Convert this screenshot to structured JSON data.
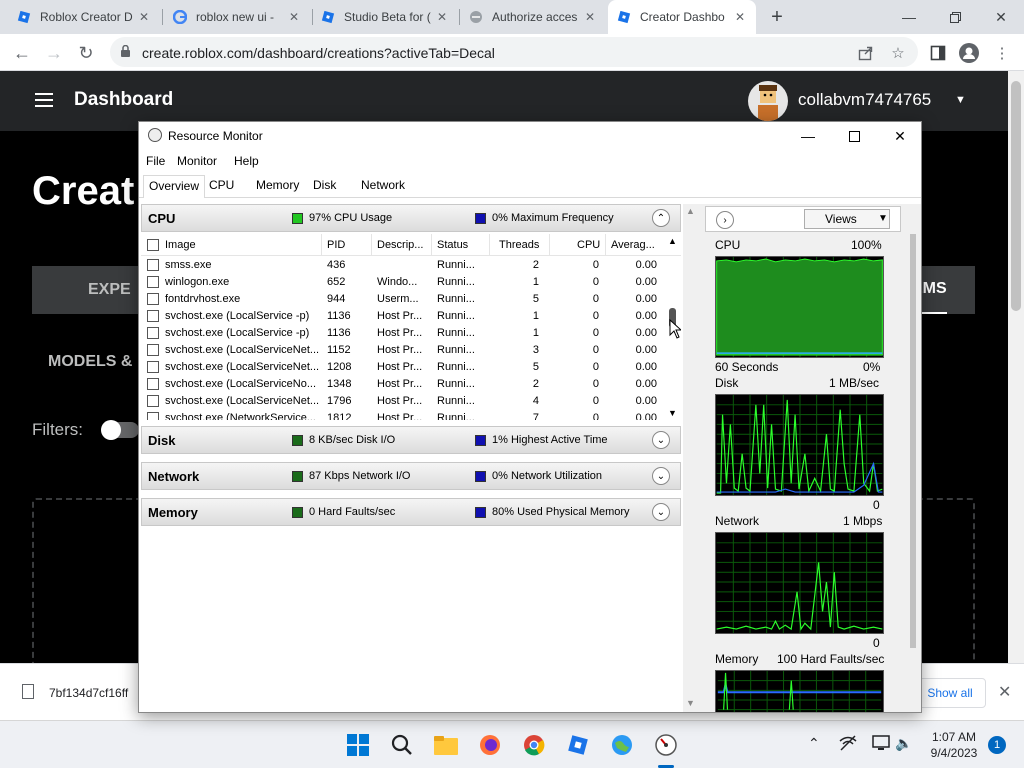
{
  "browser": {
    "tabs": [
      {
        "title": "Roblox Creator D",
        "icon": "roblox-icon"
      },
      {
        "title": "roblox new ui -",
        "icon": "google-icon"
      },
      {
        "title": "Studio Beta for (",
        "icon": "roblox-icon"
      },
      {
        "title": "Authorize acces",
        "icon": "page-icon"
      },
      {
        "title": "Creator Dashbo",
        "icon": "roblox-icon"
      }
    ],
    "url": "create.roblox.com/dashboard/creations?activeTab=Decal"
  },
  "roblox": {
    "header_title": "Dashboard",
    "username": "collabvm7474765",
    "page_heading": "Creat",
    "tab_experiences": "EXPE",
    "tab_items": "EMS",
    "models_tab": "MODELS &",
    "filters_label": "Filters:"
  },
  "download": {
    "filename": "7bf134d7cf16ff",
    "show_all": "Show all"
  },
  "taskbar": {
    "time": "1:07 AM",
    "date": "9/4/2023",
    "notifications": "1"
  },
  "resmon": {
    "title": "Resource Monitor",
    "menu": [
      "File",
      "Monitor",
      "Help"
    ],
    "tabs": [
      "Overview",
      "CPU",
      "Memory",
      "Disk",
      "Network"
    ],
    "cpu": {
      "name": "CPU",
      "stat1": "97% CPU Usage",
      "stat2": "0% Maximum Frequency"
    },
    "disk": {
      "name": "Disk",
      "stat1": "8 KB/sec Disk I/O",
      "stat2": "1% Highest Active Time"
    },
    "network": {
      "name": "Network",
      "stat1": "87 Kbps Network I/O",
      "stat2": "0% Network Utilization"
    },
    "memory": {
      "name": "Memory",
      "stat1": "0 Hard Faults/sec",
      "stat2": "80% Used Physical Memory"
    },
    "columns": [
      "Image",
      "PID",
      "Descrip...",
      "Status",
      "Threads",
      "CPU",
      "Averag..."
    ],
    "processes": [
      [
        "smss.exe",
        "436",
        "",
        "Runni...",
        "2",
        "0",
        "0.00"
      ],
      [
        "winlogon.exe",
        "652",
        "Windo...",
        "Runni...",
        "1",
        "0",
        "0.00"
      ],
      [
        "fontdrvhost.exe",
        "944",
        "Userm...",
        "Runni...",
        "5",
        "0",
        "0.00"
      ],
      [
        "svchost.exe (LocalService -p)",
        "1136",
        "Host Pr...",
        "Runni...",
        "1",
        "0",
        "0.00"
      ],
      [
        "svchost.exe (LocalService -p)",
        "1136",
        "Host Pr...",
        "Runni...",
        "1",
        "0",
        "0.00"
      ],
      [
        "svchost.exe (LocalServiceNet...",
        "1152",
        "Host Pr...",
        "Runni...",
        "3",
        "0",
        "0.00"
      ],
      [
        "svchost.exe (LocalServiceNet...",
        "1208",
        "Host Pr...",
        "Runni...",
        "5",
        "0",
        "0.00"
      ],
      [
        "svchost.exe (LocalServiceNo...",
        "1348",
        "Host Pr...",
        "Runni...",
        "2",
        "0",
        "0.00"
      ],
      [
        "svchost.exe (LocalServiceNet...",
        "1796",
        "Host Pr...",
        "Runni...",
        "4",
        "0",
        "0.00"
      ],
      [
        "svchost.exe (NetworkService...",
        "1812",
        "Host Pr...",
        "Runni...",
        "7",
        "0",
        "0.00"
      ]
    ],
    "views_label": "Views",
    "graphs": {
      "cpu_label": "CPU",
      "cpu_max": "100%",
      "cpu_time": "60 Seconds",
      "cpu_min": "0%",
      "disk_label": "Disk",
      "disk_max": "1 MB/sec",
      "disk_min": "0",
      "net_label": "Network",
      "net_max": "1 Mbps",
      "net_min": "0",
      "mem_label": "Memory",
      "mem_max": "100 Hard Faults/sec"
    },
    "colors": {
      "cpu_usage": "#22c722",
      "max_freq": "#1010b0",
      "green_dark": "#1a6b1a"
    }
  }
}
